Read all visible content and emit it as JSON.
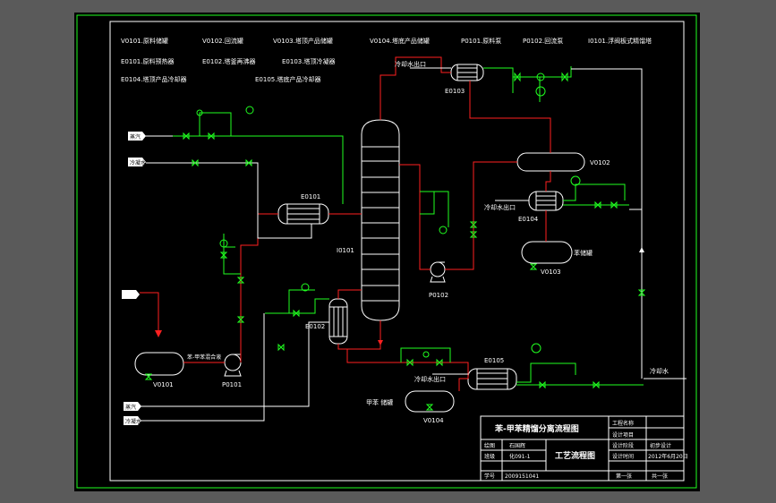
{
  "legend": {
    "row1": [
      "V0101.原料储罐",
      "V0102.回流罐",
      "V0103.塔顶产品储罐",
      "V0104.塔底产品储罐",
      "P0101.原料泵",
      "P0102.回流泵",
      "I0101.浮阀板式精馏塔"
    ],
    "row2": [
      "E0101.原料预热器",
      "E0102.塔釜再沸器",
      "E0103.塔顶冷凝器"
    ],
    "row3": [
      "E0104.塔顶产品冷却器",
      "E0105.塔底产品冷却器"
    ]
  },
  "equipment": {
    "column": "I0101",
    "e0101": "E0101",
    "e0102": "E0102",
    "e0103": "E0103",
    "e0104": "E0104",
    "e0105": "E0105",
    "v0101": "V0101",
    "v0102": "V0102",
    "v0103": "V0103",
    "v0104": "V0104",
    "p0101": "P0101",
    "p0102": "P0102"
  },
  "streams": {
    "cw_out_1": "冷却水出口",
    "cw_out_2": "冷却水出口",
    "cw_out_3": "冷却水出口",
    "cw_in": "冷却水",
    "product_v0103": "苯储罐",
    "product_v0104": "甲苯 储罐",
    "feed_tag": "苯-甲苯混合液",
    "steam_1": "蒸汽",
    "steam_2": "蒸汽",
    "cond_1": "冷凝水",
    "cond_2": "冷凝水"
  },
  "title_block": {
    "drawing_title": "苯-甲苯精馏分离流程图",
    "sheet_title": "工艺流程图",
    "label_drawn": "绘图",
    "drawer": "石国辉",
    "label_class": "班级",
    "class": "化091-1",
    "label_id": "学号",
    "student_id": "2009151041",
    "label_project": "工程名称",
    "label_design": "设计项目",
    "label_stage": "设计阶段",
    "stage": "初步设计",
    "label_date": "设计时间",
    "date": "2012年6月20日",
    "sheet_no": "第一张",
    "sheet_total": "共一张"
  }
}
